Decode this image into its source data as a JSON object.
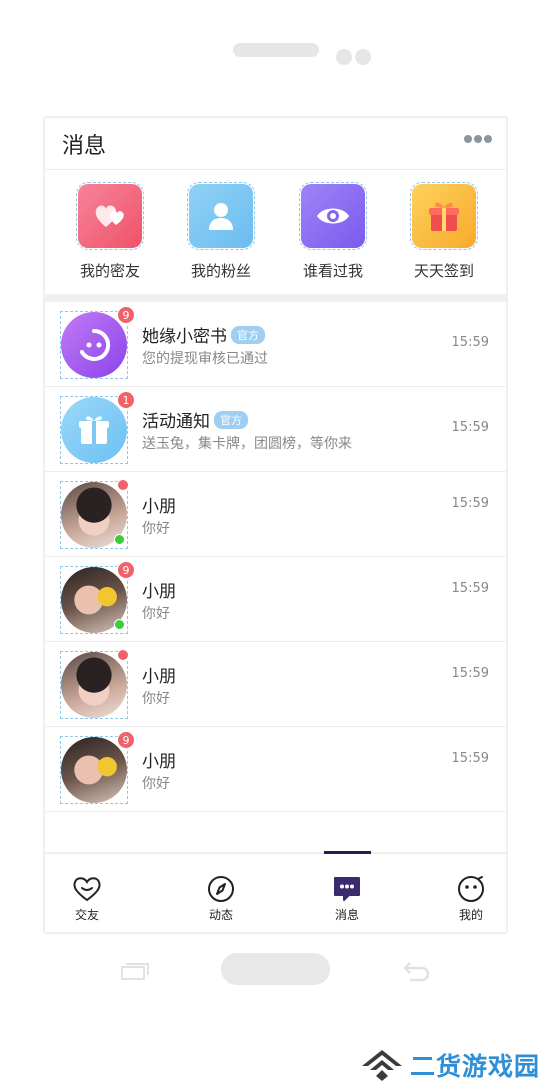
{
  "header": {
    "title": "消息",
    "more_icon": "more-dots-icon"
  },
  "quick_actions": [
    {
      "label": "我的密友",
      "icon": "hearts-icon",
      "color": "#f25f73"
    },
    {
      "label": "我的粉丝",
      "icon": "person-icon",
      "color": "#7cc7f3"
    },
    {
      "label": "谁看过我",
      "icon": "eye-icon",
      "color": "#8d6ff2"
    },
    {
      "label": "天天签到",
      "icon": "gift-box-icon",
      "color": "#fbc03c"
    }
  ],
  "messages": [
    {
      "name": "她缘小密书",
      "tag": "官方",
      "preview": "您的提现审核已通过",
      "time": "15:59",
      "badge": "9"
    },
    {
      "name": "活动通知",
      "tag": "官方",
      "preview": "送玉兔，集卡牌，团圆榜，等你来",
      "time": "15:59",
      "badge": "1"
    },
    {
      "name": "小朋",
      "preview": "你好",
      "time": "15:59",
      "badge": ""
    },
    {
      "name": "小朋",
      "preview": "你好",
      "time": "15:59",
      "badge": "9"
    },
    {
      "name": "小朋",
      "preview": "你好",
      "time": "15:59",
      "badge": ""
    },
    {
      "name": "小朋",
      "preview": "你好",
      "time": "15:59",
      "badge": "9"
    }
  ],
  "tabs": [
    {
      "label": "交友",
      "icon": "heart-outline-icon"
    },
    {
      "label": "动态",
      "icon": "compass-icon"
    },
    {
      "label": "消息",
      "icon": "chat-bubble-icon",
      "active": true
    },
    {
      "label": "我的",
      "icon": "face-icon"
    }
  ],
  "watermark": {
    "text": "二货游戏园"
  }
}
